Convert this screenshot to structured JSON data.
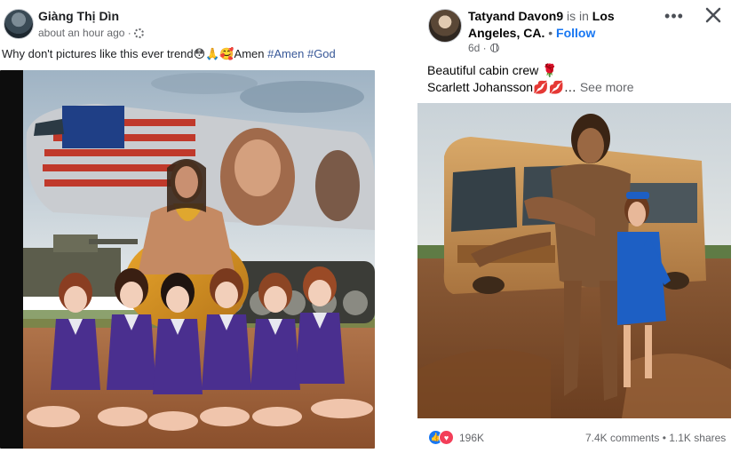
{
  "left_post": {
    "author": "Giàng Thị Dìn",
    "time": "about an hour ago ·",
    "caption_text": "Why don't pictures like this ever trend😳🙏🥰Amen ",
    "hashtags": [
      "#Amen",
      "#God"
    ],
    "image_icon": "image-jesus-airplane-flight-attendants"
  },
  "right_post": {
    "author": "Tatyand Davon9",
    "is_in": " is in ",
    "location": "Los Angeles, CA.",
    "separator": " • ",
    "follow_label": "Follow",
    "time": "6d ·",
    "text_line1": "Beautiful cabin crew 🌹",
    "text_line2": "Scarlett Johansson💋💋… ",
    "see_more": "See more",
    "more_icon": "more-options-icon",
    "close_icon": "close-icon",
    "reaction_count": "196K",
    "comments": "7.4K comments",
    "stats_sep": " • ",
    "shares": "1.1K shares",
    "image_icon": "image-jesus-carrying-flight-attendant-bus"
  },
  "colors": {
    "link_blue": "#1877f2",
    "hashtag_blue": "#385898",
    "muted_gray": "#65676b",
    "flight_attendant_purple": "#4a2f8f"
  }
}
